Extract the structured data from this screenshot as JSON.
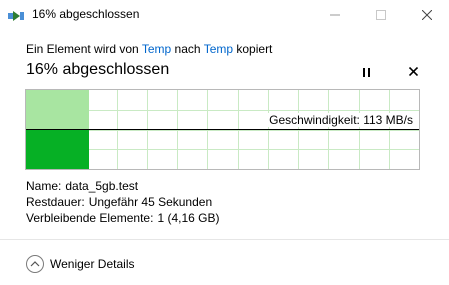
{
  "window": {
    "title": "16% abgeschlossen",
    "minimize_icon": "minimize-icon",
    "maximize_icon": "maximize-icon",
    "close_icon": "close-icon"
  },
  "copy": {
    "prefix": "Ein Element wird von",
    "source": "Temp",
    "middle": "nach",
    "destination": "Temp",
    "suffix": "kopiert",
    "progress_text": "16% abgeschlossen",
    "progress": 0.16,
    "pause_icon": "pause-icon",
    "cancel_icon": "cancel-icon"
  },
  "graph": {
    "speed_label": "Geschwindigkeit: 113 MB/s",
    "fill_color": "#06b025",
    "fill_light": "#a8e5a1",
    "grid_color": "#c9eac4"
  },
  "details": {
    "name_label": "Name:",
    "name_value": "data_5gb.test",
    "time_label": "Restdauer:",
    "time_value": "Ungefähr 45 Sekunden",
    "items_label": "Verbleibende Elemente:",
    "items_value": "1 (4,16 GB)"
  },
  "toggle": {
    "label": "Weniger Details",
    "icon": "chevron-up-icon"
  }
}
